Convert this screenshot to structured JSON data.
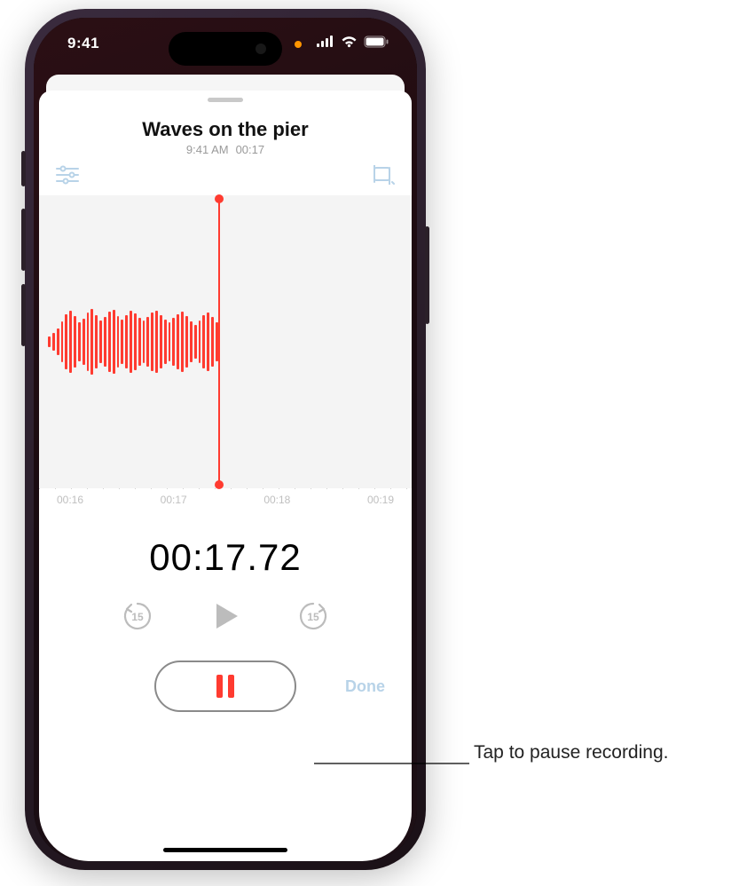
{
  "status_bar": {
    "time": "9:41"
  },
  "recording": {
    "title": "Waves on the pier",
    "subtitle_time": "9:41 AM",
    "subtitle_duration": "00:17"
  },
  "timeline": {
    "ticks": [
      "00:16",
      "00:17",
      "00:18",
      "00:19"
    ]
  },
  "counter": "00:17.72",
  "skip_seconds": "15",
  "done_label": "Done",
  "callout": "Tap to pause recording.",
  "colors": {
    "accent": "#ff3b30",
    "disabled_tint": "#b8d3e8"
  }
}
